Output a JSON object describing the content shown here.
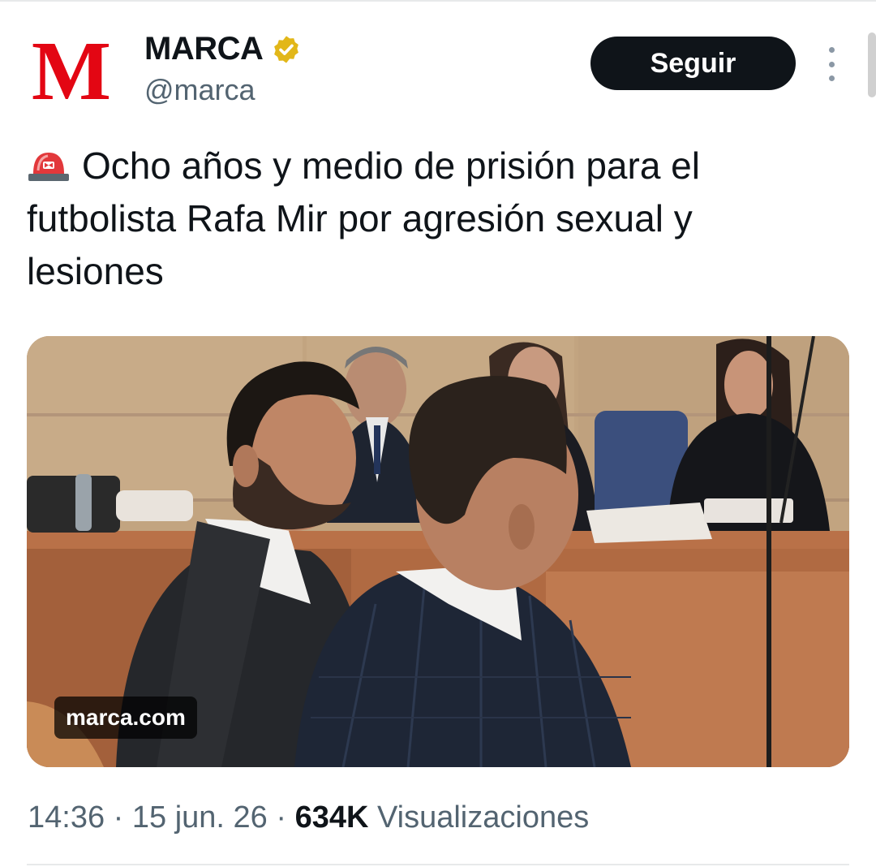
{
  "account": {
    "display_name": "MARCA",
    "handle": "@marca",
    "avatar_letter": "M",
    "verified": true
  },
  "follow_label": "Seguir",
  "tweet": {
    "emoji": "🚨",
    "text": "Ocho años y medio de prisión para el futbolista Rafa Mir por agresión sexual y lesiones"
  },
  "media": {
    "domain": "marca.com"
  },
  "meta": {
    "time": "14:36",
    "separator": "·",
    "date": "15 jun. 26",
    "views_count": "634K",
    "views_label": "Visualizaciones"
  },
  "colors": {
    "brand_red": "#e30613",
    "verified_gold": "#e2b719",
    "follow_bg": "#0f1419",
    "muted_text": "#536471"
  }
}
